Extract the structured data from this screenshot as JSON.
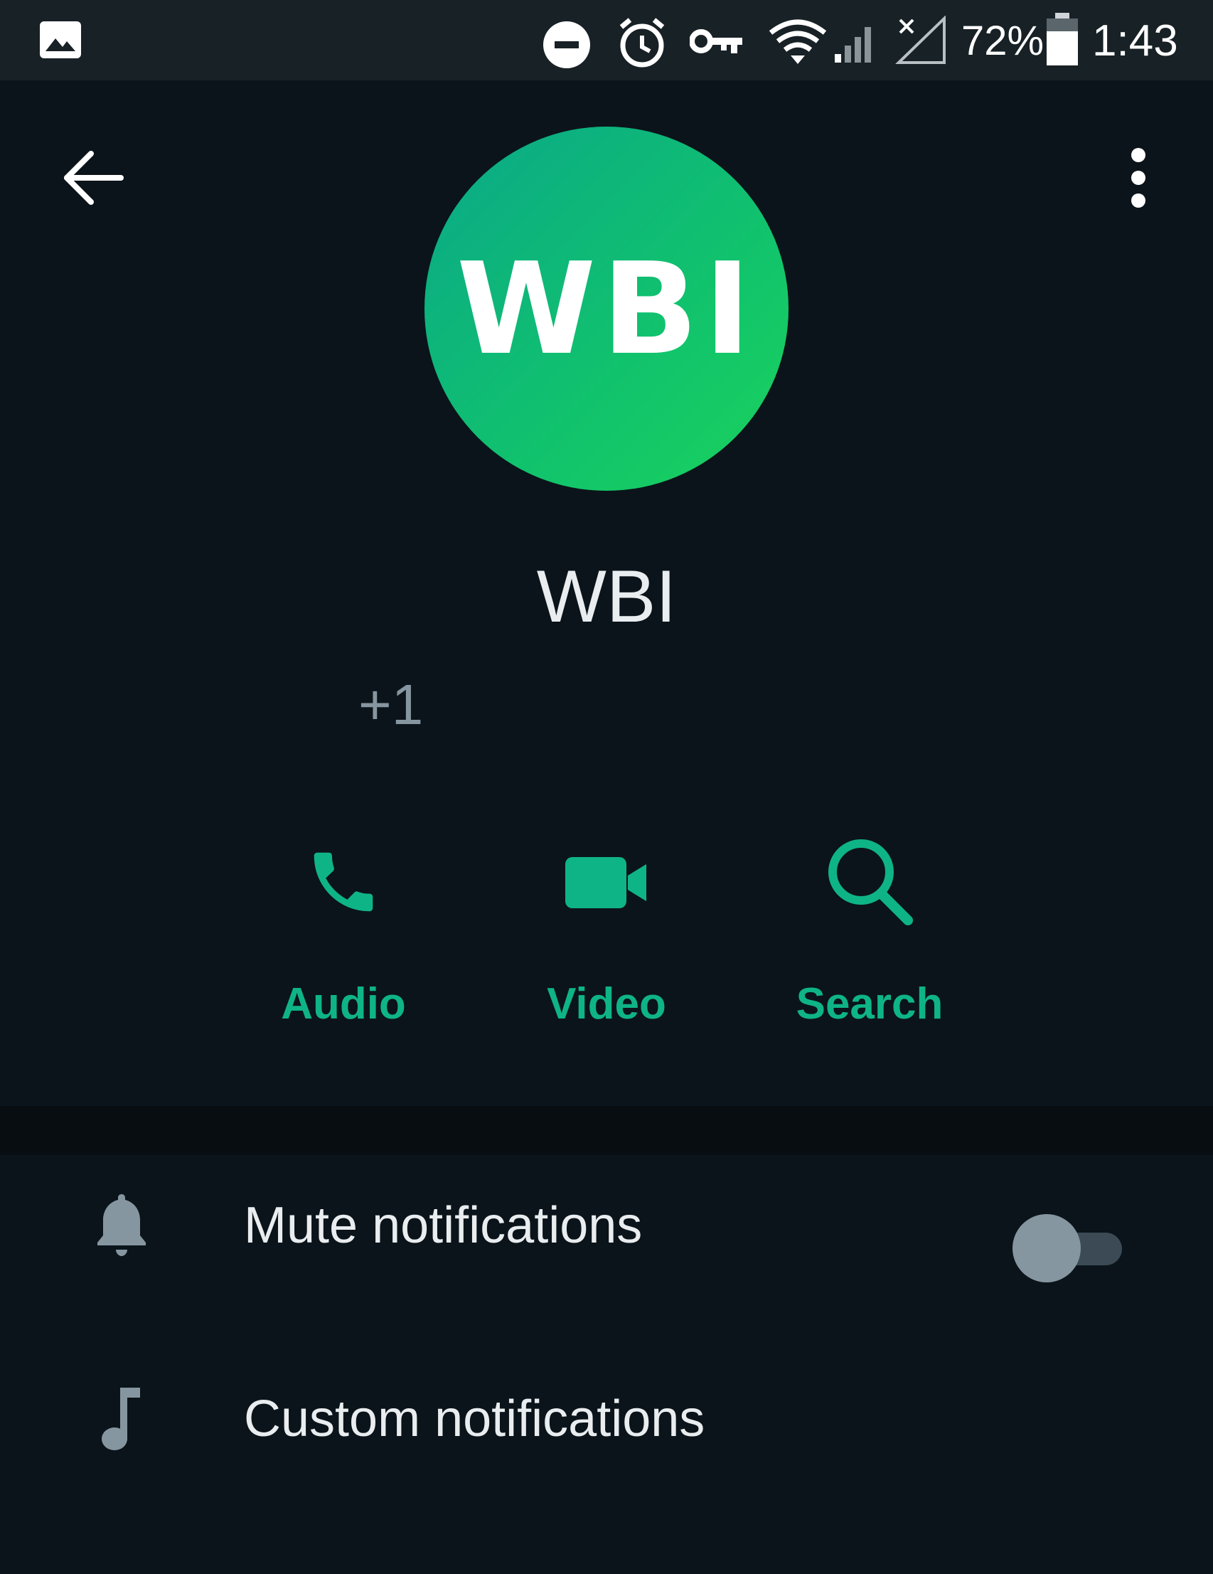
{
  "status_bar": {
    "icons": [
      "gallery-icon",
      "do-not-disturb-icon",
      "alarm-icon",
      "vpn-key-icon",
      "wifi-icon",
      "cell-signal-icon",
      "no-signal-icon",
      "battery-icon"
    ],
    "battery_percent": "72%",
    "time": "1:43"
  },
  "header": {
    "back_icon": "arrow-left-icon",
    "menu_icon": "more-vertical-icon"
  },
  "profile": {
    "avatar_text": "WBI",
    "avatar_colors": [
      "#0aa889",
      "#19d35c"
    ],
    "name": "WBI",
    "phone": "+1"
  },
  "actions": [
    {
      "icon": "phone-icon",
      "label": "Audio"
    },
    {
      "icon": "video-camera-icon",
      "label": "Video"
    },
    {
      "icon": "search-icon",
      "label": "Search"
    }
  ],
  "settings": [
    {
      "icon": "bell-icon",
      "label": "Mute notifications",
      "toggle": false
    },
    {
      "icon": "music-note-icon",
      "label": "Custom notifications"
    }
  ],
  "colors": {
    "background": "#0b141a",
    "status_bar": "#172126",
    "accent": "#0fb486",
    "text_primary": "#e9edef",
    "text_secondary": "#8696a0"
  }
}
